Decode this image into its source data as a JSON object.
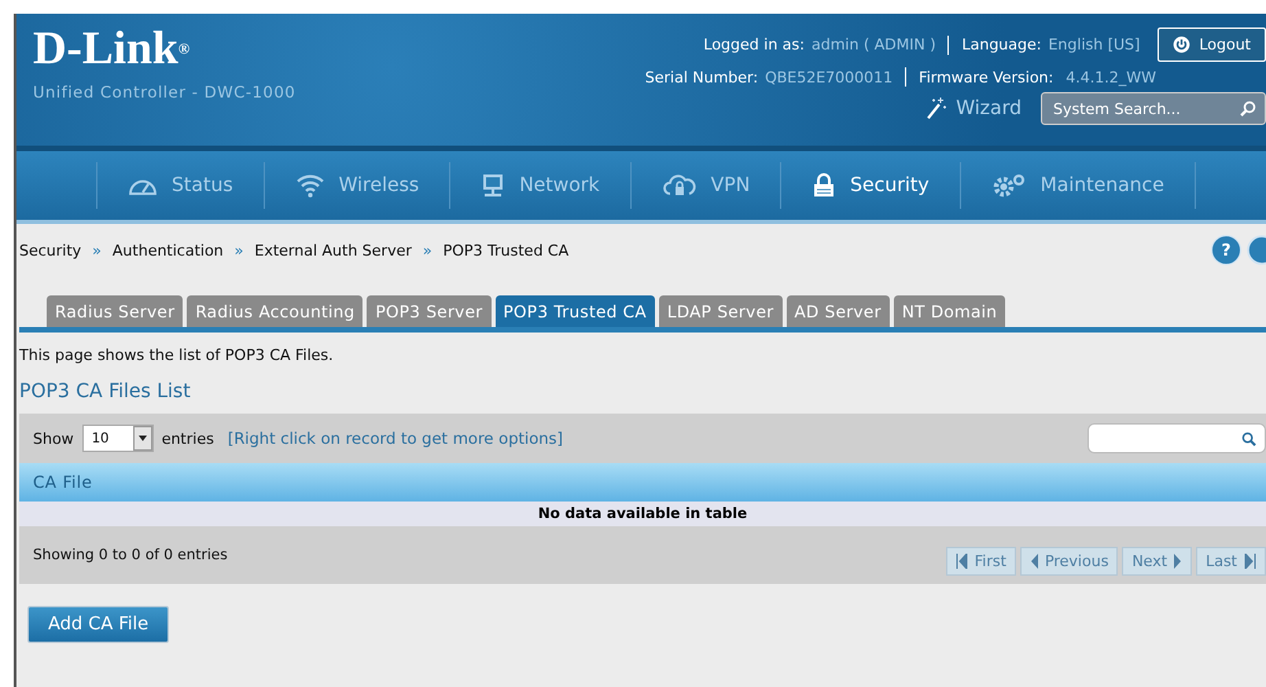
{
  "header": {
    "logo": "D-Link",
    "logo_mark": "®",
    "subtitle": "Unified Controller - DWC-1000",
    "logged_in_label": "Logged in as:",
    "logged_in_value": "admin ( ADMIN )",
    "language_label": "Language:",
    "language_value": "English [US]",
    "logout": "Logout",
    "serial_label": "Serial Number:",
    "serial_value": "QBE52E7000011",
    "firmware_label": "Firmware Version:",
    "firmware_value": "4.4.1.2_WW",
    "wizard": "Wizard",
    "search": {
      "placeholder": "System Search..."
    }
  },
  "nav": [
    {
      "label": "Status",
      "selected": false
    },
    {
      "label": "Wireless",
      "selected": false
    },
    {
      "label": "Network",
      "selected": false
    },
    {
      "label": "VPN",
      "selected": false
    },
    {
      "label": "Security",
      "selected": true
    },
    {
      "label": "Maintenance",
      "selected": false
    }
  ],
  "help": "?",
  "breadcrumb": [
    "Security",
    "Authentication",
    "External Auth Server",
    "POP3 Trusted CA"
  ],
  "breadcrumb_separator": "»",
  "tabs": [
    {
      "label": "Radius Server",
      "selected": false
    },
    {
      "label": "Radius Accounting",
      "selected": false
    },
    {
      "label": "POP3 Server",
      "selected": false
    },
    {
      "label": "POP3 Trusted CA",
      "selected": true
    },
    {
      "label": "LDAP Server",
      "selected": false
    },
    {
      "label": "AD Server",
      "selected": false
    },
    {
      "label": "NT Domain",
      "selected": false
    }
  ],
  "description": "This page shows the list of POP3 CA Files.",
  "section_title": "POP3 CA Files List",
  "table": {
    "show_label": "Show",
    "entries_value": "10",
    "entries_label": "entries",
    "hint": "[Right click on record to get more options]",
    "columns": [
      "CA File"
    ],
    "empty_message": "No data available in table",
    "info": "Showing 0 to 0 of 0 entries",
    "pager": [
      {
        "label": "First",
        "kind": "first",
        "disabled": true
      },
      {
        "label": "Previous",
        "kind": "prev",
        "disabled": true
      },
      {
        "label": "Next",
        "kind": "next",
        "disabled": true
      },
      {
        "label": "Last",
        "kind": "last",
        "disabled": true
      }
    ]
  },
  "add_button": "Add CA File"
}
